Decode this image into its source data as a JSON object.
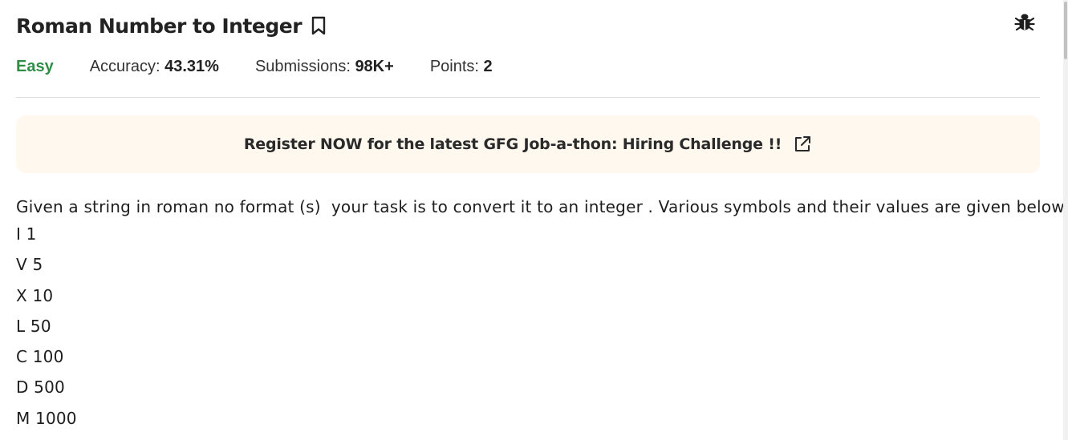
{
  "problem": {
    "title": "Roman Number to Integer",
    "difficulty": "Easy",
    "accuracy_label": "Accuracy:",
    "accuracy_value": "43.31%",
    "submissions_label": "Submissions:",
    "submissions_value": "98K+",
    "points_label": "Points:",
    "points_value": "2"
  },
  "banner": {
    "text": "Register NOW for the latest GFG Job-a-thon: Hiring Challenge !!"
  },
  "description": {
    "intro": "Given a string in roman no format (s)  your task is to convert it to an integer . Various symbols and their values are given below.",
    "symbols": [
      "I 1",
      "V 5",
      "X 10",
      "L 50",
      "C 100",
      "D 500",
      "M 1000"
    ]
  },
  "icons": {
    "bookmark": "bookmark-icon",
    "bug": "bug-icon",
    "external_link": "external-link-icon"
  },
  "colors": {
    "difficulty_easy": "#2f8d46",
    "banner_bg": "#fff8ee",
    "text": "#1e1e1e"
  }
}
